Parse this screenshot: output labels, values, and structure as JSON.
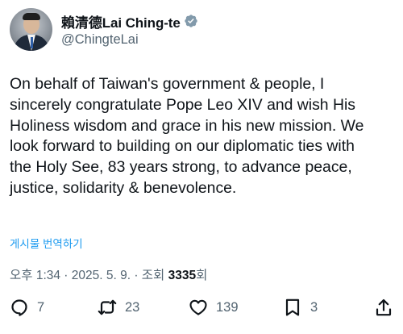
{
  "user": {
    "display_name": "賴清德Lai Ching-te",
    "handle": "@ChingteLai",
    "verified": true
  },
  "tweet": {
    "lines": [
      "On behalf of Taiwan's government & people, I",
      "sincerely congratulate Pope Leo XIV and wish His",
      "Holiness wisdom and grace in his new mission. We",
      "look forward to building on our diplomatic ties with",
      "the Holy See, 83 years strong, to advance peace,",
      "justice, solidarity & benevolence."
    ]
  },
  "translate_label": "게시물 번역하기",
  "meta": {
    "timestamp": "오후 1:34 · 2025. 5. 9. · 조회 ",
    "views_count": "3335",
    "views_suffix": "회"
  },
  "actions": {
    "reply_count": "7",
    "repost_count": "23",
    "like_count": "139",
    "bookmark_count": "3"
  },
  "colors": {
    "text": "#0f1419",
    "secondary": "#536471",
    "accent": "#1d9bf0"
  },
  "icons": [
    "verified-badge-icon",
    "reply-icon",
    "repost-icon",
    "like-icon",
    "bookmark-icon",
    "share-icon"
  ]
}
